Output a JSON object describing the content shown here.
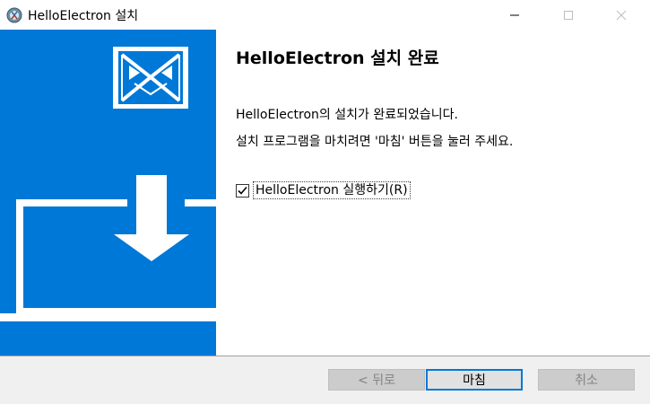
{
  "window": {
    "title": "HelloElectron 설치",
    "icon": "installer-app-icon",
    "controls": [
      "minimize-icon",
      "maximize-icon",
      "close-icon"
    ]
  },
  "banner": {
    "background": "#0078d7",
    "icons": [
      "envelope-logo-icon",
      "laptop-download-icon"
    ]
  },
  "content": {
    "heading": "HelloElectron 설치 완료",
    "message_line1": "HelloElectron의 설치가 완료되었습니다.",
    "message_line2": "설치 프로그램을 마치려면 '마침' 버튼을 눌러 주세요.",
    "run_checkbox": {
      "label": "HelloElectron 실행하기(R)",
      "checked": true
    }
  },
  "footer": {
    "back_label": "< 뒤로",
    "finish_label": "마침",
    "cancel_label": "취소"
  },
  "colors": {
    "accent": "#0078d7",
    "footer_bg": "#f0f0f0",
    "disabled_text": "#838383"
  }
}
